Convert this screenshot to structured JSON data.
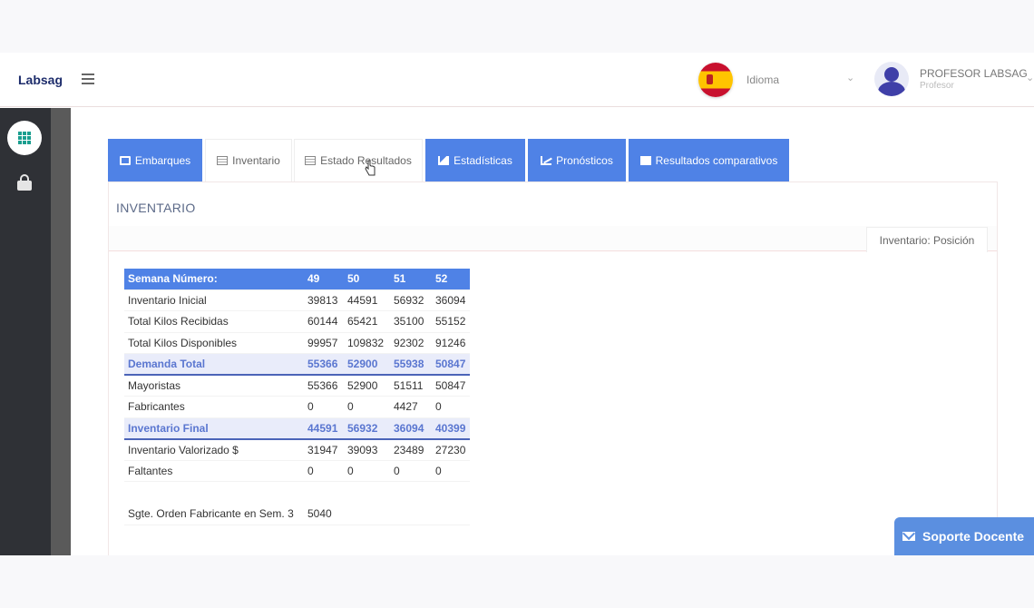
{
  "brand": "Labsag",
  "language": {
    "label": "Idioma"
  },
  "user": {
    "name": "PROFESOR LABSAG",
    "role": "Profesor"
  },
  "tabs": [
    {
      "label": "Embarques",
      "icon": "truck-icon",
      "active": true
    },
    {
      "label": "Inventario",
      "icon": "table-icon",
      "active": false
    },
    {
      "label": "Estado Resultados",
      "icon": "table-icon",
      "active": false
    },
    {
      "label": "Estadísticas",
      "icon": "area-chart-icon",
      "active": true
    },
    {
      "label": "Pronósticos",
      "icon": "line-chart-icon",
      "active": true
    },
    {
      "label": "Resultados comparativos",
      "icon": "document-icon",
      "active": true
    }
  ],
  "panel": {
    "title": "INVENTARIO",
    "subtab": "Inventario: Posición"
  },
  "table": {
    "header": [
      "Semana Número:",
      "49",
      "50",
      "51",
      "52"
    ],
    "rows": [
      [
        "Inventario Inicial",
        "39813",
        "44591",
        "56932",
        "36094"
      ],
      [
        "Total Kilos Recibidas",
        "60144",
        "65421",
        "35100",
        "55152"
      ],
      [
        "Total Kilos Disponibles",
        "99957",
        "109832",
        "92302",
        "91246"
      ],
      [
        "Demanda Total",
        "55366",
        "52900",
        "55938",
        "50847"
      ],
      [
        "Mayoristas",
        "55366",
        "52900",
        "51511",
        "50847"
      ],
      [
        "Fabricantes",
        "0",
        "0",
        "4427",
        "0"
      ],
      [
        "Inventario Final",
        "44591",
        "56932",
        "36094",
        "40399"
      ],
      [
        "Inventario Valorizado $",
        "31947",
        "39093",
        "23489",
        "27230"
      ],
      [
        "Faltantes",
        "0",
        "0",
        "0",
        "0"
      ]
    ],
    "footer": [
      "Sgte. Orden Fabricante en Sem. 3",
      "5040"
    ]
  },
  "support_label": "Soporte Docente",
  "colors": {
    "accent": "#4f82e6",
    "sidebar": "#2f3136",
    "brand": "#1d2c6b",
    "highlight": "#5a76d0"
  }
}
